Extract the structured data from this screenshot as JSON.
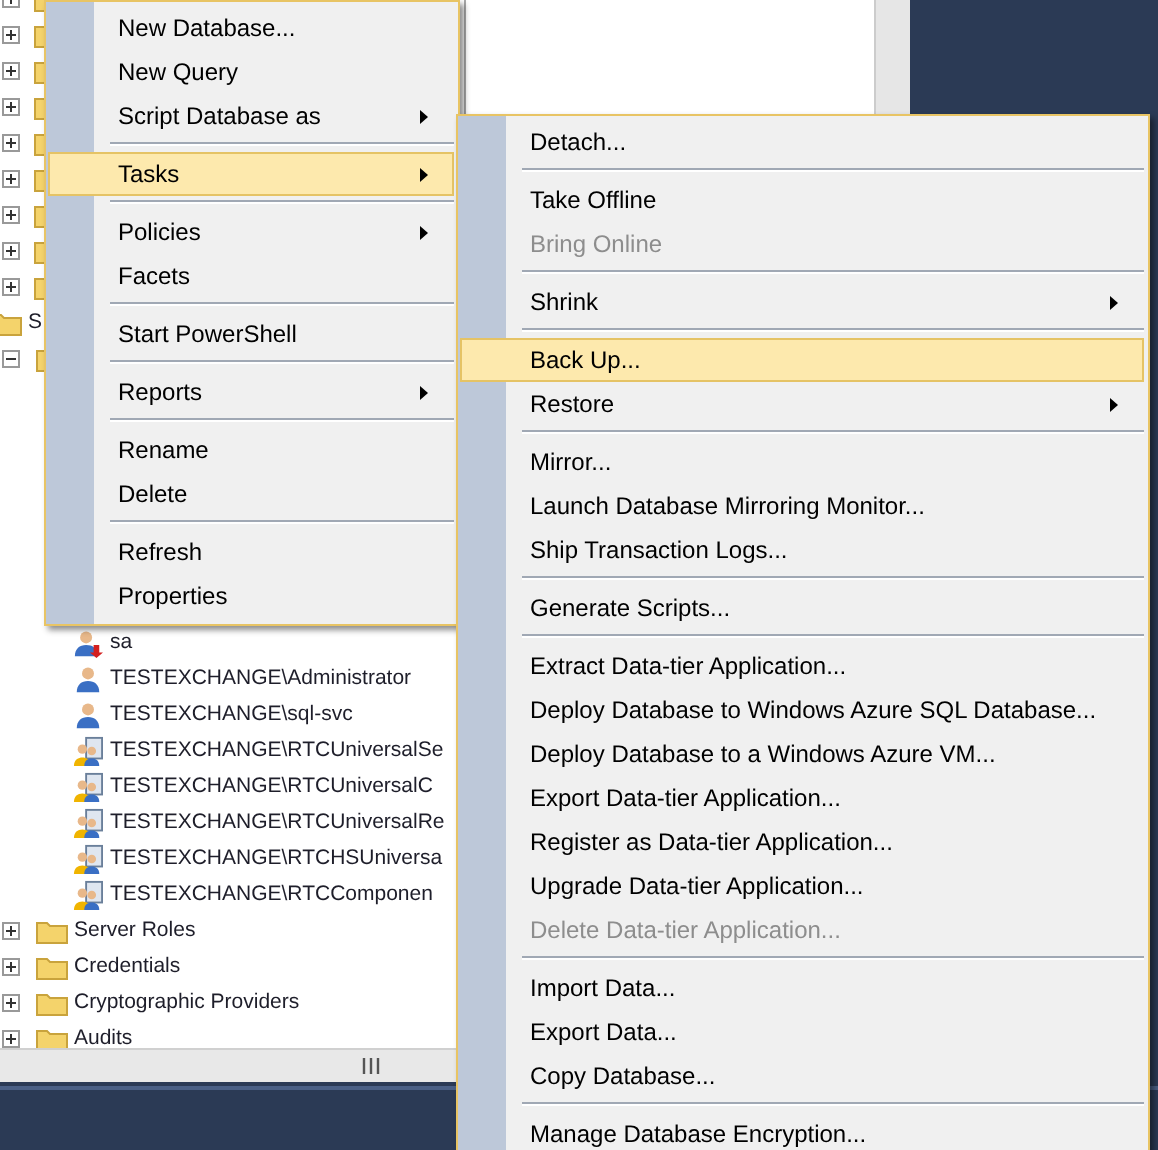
{
  "tree": {
    "upper_nodes": [
      {
        "expanded": false
      },
      {
        "expanded": false
      },
      {
        "expanded": false
      },
      {
        "expanded": false
      },
      {
        "expanded": false
      },
      {
        "expanded": false
      },
      {
        "expanded": false
      },
      {
        "expanded": false
      },
      {
        "expanded": false
      }
    ],
    "nodes": [
      {
        "label": "S",
        "kind": "folder",
        "children": [
          {
            "kind": "folder",
            "expanded": true,
            "children": [
              {
                "label": "sa",
                "kind": "disabled-login"
              },
              {
                "label": "TESTEXCHANGE\\Administrator",
                "kind": "login"
              },
              {
                "label": "TESTEXCHANGE\\sql-svc",
                "kind": "login"
              },
              {
                "label": "TESTEXCHANGE\\RTCUniversalSe",
                "kind": "group"
              },
              {
                "label": "TESTEXCHANGE\\RTCUniversalC",
                "kind": "group"
              },
              {
                "label": "TESTEXCHANGE\\RTCUniversalRe",
                "kind": "group"
              },
              {
                "label": "TESTEXCHANGE\\RTCHSUniversa",
                "kind": "group"
              },
              {
                "label": "TESTEXCHANGE\\RTCComponen",
                "kind": "group"
              }
            ]
          },
          {
            "label": "Server Roles",
            "kind": "folder",
            "expanded": false
          },
          {
            "label": "Credentials",
            "kind": "folder",
            "expanded": false
          },
          {
            "label": "Cryptographic Providers",
            "kind": "folder",
            "expanded": false
          },
          {
            "label": "Audits",
            "kind": "folder",
            "expanded": false
          }
        ]
      }
    ]
  },
  "context_menu": [
    {
      "kind": "item",
      "label": "New Database...",
      "selected": false,
      "disabled": false,
      "submenu": false
    },
    {
      "kind": "item",
      "label": "New Query",
      "selected": false,
      "disabled": false,
      "submenu": false
    },
    {
      "kind": "item",
      "label": "Script Database as",
      "selected": false,
      "disabled": false,
      "submenu": true
    },
    {
      "kind": "separator"
    },
    {
      "kind": "item",
      "label": "Tasks",
      "selected": true,
      "disabled": false,
      "submenu": true
    },
    {
      "kind": "separator"
    },
    {
      "kind": "item",
      "label": "Policies",
      "selected": false,
      "disabled": false,
      "submenu": true
    },
    {
      "kind": "item",
      "label": "Facets",
      "selected": false,
      "disabled": false,
      "submenu": false
    },
    {
      "kind": "separator"
    },
    {
      "kind": "item",
      "label": "Start PowerShell",
      "selected": false,
      "disabled": false,
      "submenu": false
    },
    {
      "kind": "separator"
    },
    {
      "kind": "item",
      "label": "Reports",
      "selected": false,
      "disabled": false,
      "submenu": true
    },
    {
      "kind": "separator"
    },
    {
      "kind": "item",
      "label": "Rename",
      "selected": false,
      "disabled": false,
      "submenu": false
    },
    {
      "kind": "item",
      "label": "Delete",
      "selected": false,
      "disabled": false,
      "submenu": false
    },
    {
      "kind": "separator"
    },
    {
      "kind": "item",
      "label": "Refresh",
      "selected": false,
      "disabled": false,
      "submenu": false
    },
    {
      "kind": "item",
      "label": "Properties",
      "selected": false,
      "disabled": false,
      "submenu": false
    }
  ],
  "tasks_submenu": [
    {
      "kind": "item",
      "label": "Detach...",
      "selected": false,
      "disabled": false,
      "submenu": false
    },
    {
      "kind": "separator"
    },
    {
      "kind": "item",
      "label": "Take Offline",
      "selected": false,
      "disabled": false,
      "submenu": false
    },
    {
      "kind": "item",
      "label": "Bring Online",
      "selected": false,
      "disabled": true,
      "submenu": false
    },
    {
      "kind": "separator"
    },
    {
      "kind": "item",
      "label": "Shrink",
      "selected": false,
      "disabled": false,
      "submenu": true
    },
    {
      "kind": "separator"
    },
    {
      "kind": "item",
      "label": "Back Up...",
      "selected": true,
      "disabled": false,
      "submenu": false
    },
    {
      "kind": "item",
      "label": "Restore",
      "selected": false,
      "disabled": false,
      "submenu": true
    },
    {
      "kind": "separator"
    },
    {
      "kind": "item",
      "label": "Mirror...",
      "selected": false,
      "disabled": false,
      "submenu": false
    },
    {
      "kind": "item",
      "label": "Launch Database Mirroring Monitor...",
      "selected": false,
      "disabled": false,
      "submenu": false
    },
    {
      "kind": "item",
      "label": "Ship Transaction Logs...",
      "selected": false,
      "disabled": false,
      "submenu": false
    },
    {
      "kind": "separator"
    },
    {
      "kind": "item",
      "label": "Generate Scripts...",
      "selected": false,
      "disabled": false,
      "submenu": false
    },
    {
      "kind": "separator"
    },
    {
      "kind": "item",
      "label": "Extract Data-tier Application...",
      "selected": false,
      "disabled": false,
      "submenu": false
    },
    {
      "kind": "item",
      "label": "Deploy Database to Windows Azure SQL Database...",
      "selected": false,
      "disabled": false,
      "submenu": false
    },
    {
      "kind": "item",
      "label": "Deploy Database to a Windows Azure VM...",
      "selected": false,
      "disabled": false,
      "submenu": false
    },
    {
      "kind": "item",
      "label": "Export Data-tier Application...",
      "selected": false,
      "disabled": false,
      "submenu": false
    },
    {
      "kind": "item",
      "label": "Register as Data-tier Application...",
      "selected": false,
      "disabled": false,
      "submenu": false
    },
    {
      "kind": "item",
      "label": "Upgrade Data-tier Application...",
      "selected": false,
      "disabled": false,
      "submenu": false
    },
    {
      "kind": "item",
      "label": "Delete Data-tier Application...",
      "selected": false,
      "disabled": true,
      "submenu": false
    },
    {
      "kind": "separator"
    },
    {
      "kind": "item",
      "label": "Import Data...",
      "selected": false,
      "disabled": false,
      "submenu": false
    },
    {
      "kind": "item",
      "label": "Export Data...",
      "selected": false,
      "disabled": false,
      "submenu": false
    },
    {
      "kind": "item",
      "label": "Copy Database...",
      "selected": false,
      "disabled": false,
      "submenu": false
    },
    {
      "kind": "separator"
    },
    {
      "kind": "item",
      "label": "Manage Database Encryption...",
      "selected": false,
      "disabled": false,
      "submenu": false
    }
  ]
}
